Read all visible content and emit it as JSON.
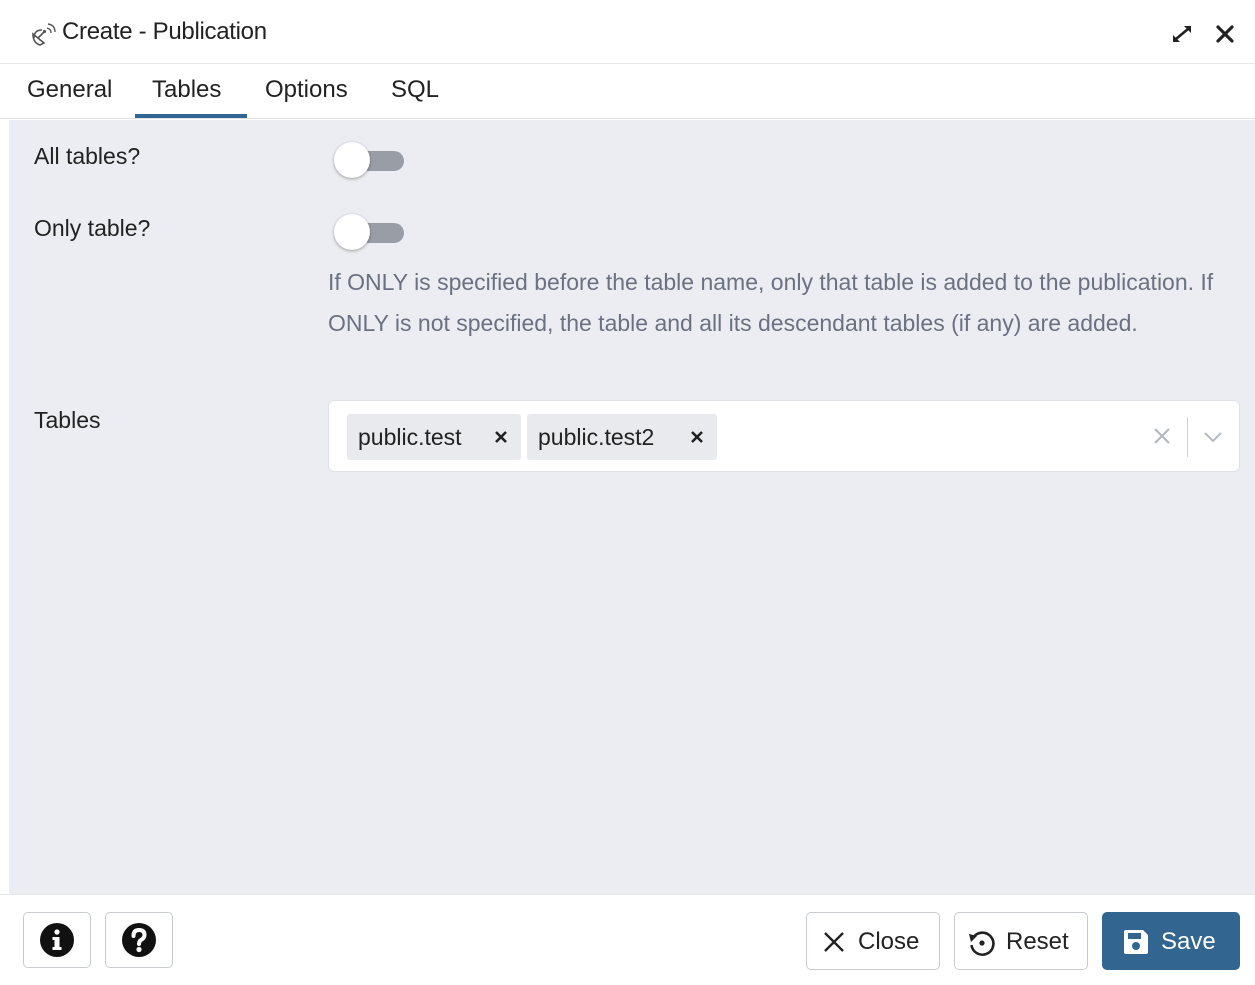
{
  "window": {
    "title": "Create - Publication",
    "icon": "publication-icon",
    "maximize_icon": "maximize-icon",
    "close_icon": "close-icon"
  },
  "tabs": [
    {
      "label": "General",
      "active": false
    },
    {
      "label": "Tables",
      "active": true
    },
    {
      "label": "Options",
      "active": false
    },
    {
      "label": "SQL",
      "active": false
    }
  ],
  "form": {
    "all_tables": {
      "label": "All tables?",
      "value": false
    },
    "only_table": {
      "label": "Only table?",
      "value": false,
      "help": "If ONLY is specified before the table name, only that table is added to the publication. If ONLY is not specified, the table and all its descendant tables (if any) are added."
    },
    "tables": {
      "label": "Tables",
      "selected": [
        "public.test",
        "public.test2"
      ]
    }
  },
  "footer": {
    "info_icon": "info-icon",
    "help_icon": "help-icon",
    "close_label": "Close",
    "reset_label": "Reset",
    "save_label": "Save"
  },
  "colors": {
    "accent": "#326690",
    "panel_bg": "#ebedf2",
    "help_text": "#6b7180"
  }
}
